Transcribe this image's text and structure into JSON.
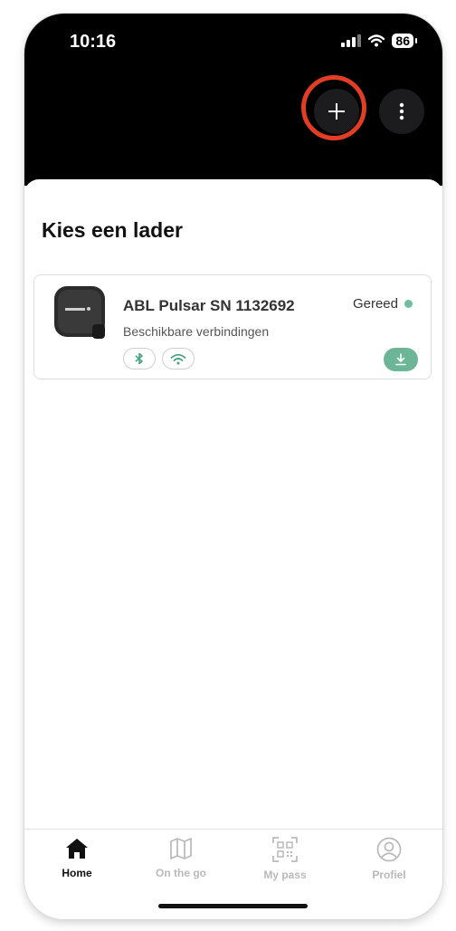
{
  "status_bar": {
    "time": "10:16",
    "battery": "86"
  },
  "header": {
    "add_label": "+",
    "more_label": "more"
  },
  "page": {
    "title": "Kies een lader"
  },
  "charger": {
    "name": "ABL Pulsar SN 1132692",
    "subtitle": "Beschikbare verbindingen",
    "status": "Gereed",
    "status_color": "#6cbf9a",
    "connections": [
      "bluetooth-icon",
      "wifi-icon"
    ]
  },
  "tabbar": {
    "items": [
      {
        "label": "Home",
        "icon": "home-icon",
        "active": true
      },
      {
        "label": "On the go",
        "icon": "map-icon",
        "active": false
      },
      {
        "label": "My pass",
        "icon": "qr-code-icon",
        "active": false
      },
      {
        "label": "Profiel",
        "icon": "profile-icon",
        "active": false
      }
    ]
  },
  "colors": {
    "accent": "#6cb597",
    "highlight_ring": "#e23d25",
    "header_bg": "#000000"
  }
}
